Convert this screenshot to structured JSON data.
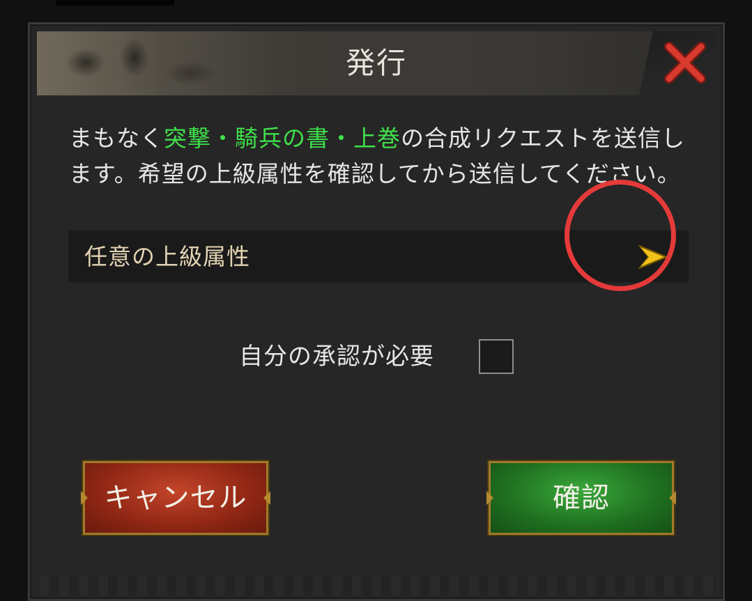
{
  "dialog": {
    "title": "発行",
    "message": {
      "prefix": "まもなく",
      "item_name": "突撃・騎兵の書・上巻",
      "suffix": "の合成リクエストを送信します。希望の上級属性を確認してから送信してください。"
    },
    "attribute_selector": {
      "label": "任意の上級属性",
      "arrow_icon": "chevron-right-icon"
    },
    "require_approval": {
      "label": "自分の承認が必要",
      "checked": false
    },
    "buttons": {
      "cancel": "キャンセル",
      "confirm": "確認"
    }
  },
  "colors": {
    "highlight": "#3fe04a",
    "annotation": "#e43a3a",
    "cancel": "#a8321c",
    "confirm": "#2a8a2c",
    "close_icon": "#d93a2e",
    "arrow": "#f2c21b"
  }
}
